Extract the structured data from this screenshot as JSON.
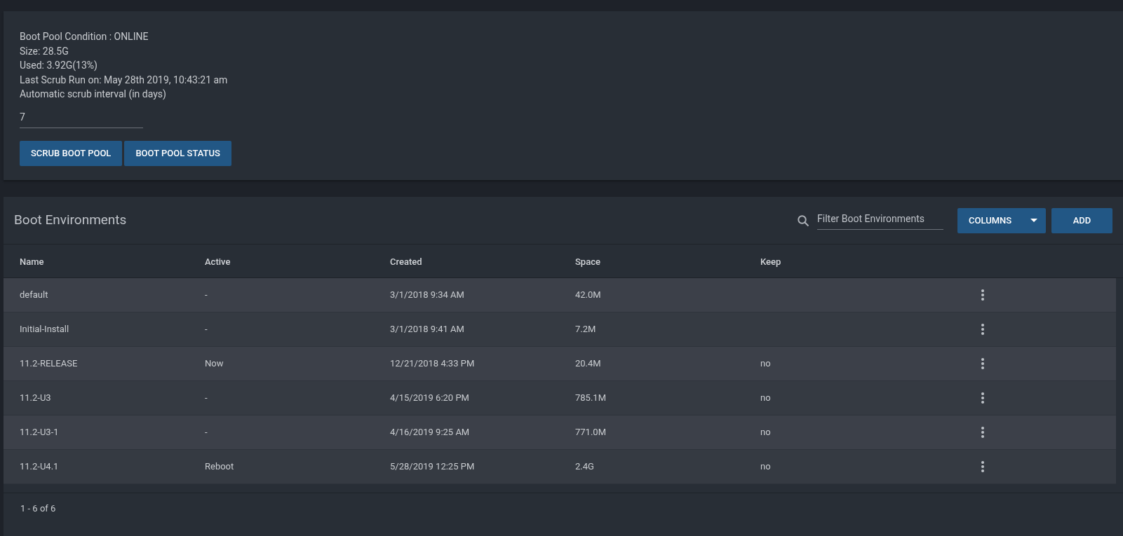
{
  "boot_pool": {
    "info_lines": [
      "Boot Pool Condition : ONLINE",
      "Size: 28.5G",
      "Used: 3.92G(13%)",
      "Last Scrub Run on: May 28th 2019, 10:43:21 am",
      "Automatic scrub interval (in days)"
    ],
    "interval_value": "7",
    "buttons": [
      "SCRUB BOOT POOL",
      "BOOT POOL STATUS"
    ]
  },
  "boot_environments": {
    "title": "Boot Environments",
    "filter": {
      "placeholder": "Filter Boot Environments"
    },
    "columns_button": "COLUMNS",
    "add_button": "ADD",
    "table": {
      "columns": [
        "Name",
        "Active",
        "Created",
        "Space",
        "Keep"
      ],
      "rows": [
        {
          "cells": [
            "default",
            "-",
            "3/1/2018 9:34 AM",
            "42.0M",
            ""
          ]
        },
        {
          "cells": [
            "Initial-Install",
            "-",
            "3/1/2018 9:41 AM",
            "7.2M",
            ""
          ]
        },
        {
          "cells": [
            "11.2-RELEASE",
            "Now",
            "12/21/2018 4:33 PM",
            "20.4M",
            "no"
          ]
        },
        {
          "cells": [
            "11.2-U3",
            "-",
            "4/15/2019 6:20 PM",
            "785.1M",
            "no"
          ]
        },
        {
          "cells": [
            "11.2-U3-1",
            "-",
            "4/16/2019 9:25 AM",
            "771.0M",
            "no"
          ]
        },
        {
          "cells": [
            "11.2-U4.1",
            "Reboot",
            "5/28/2019 12:25 PM",
            "2.4G",
            "no"
          ]
        }
      ]
    },
    "pagination": "1 - 6 of 6"
  }
}
